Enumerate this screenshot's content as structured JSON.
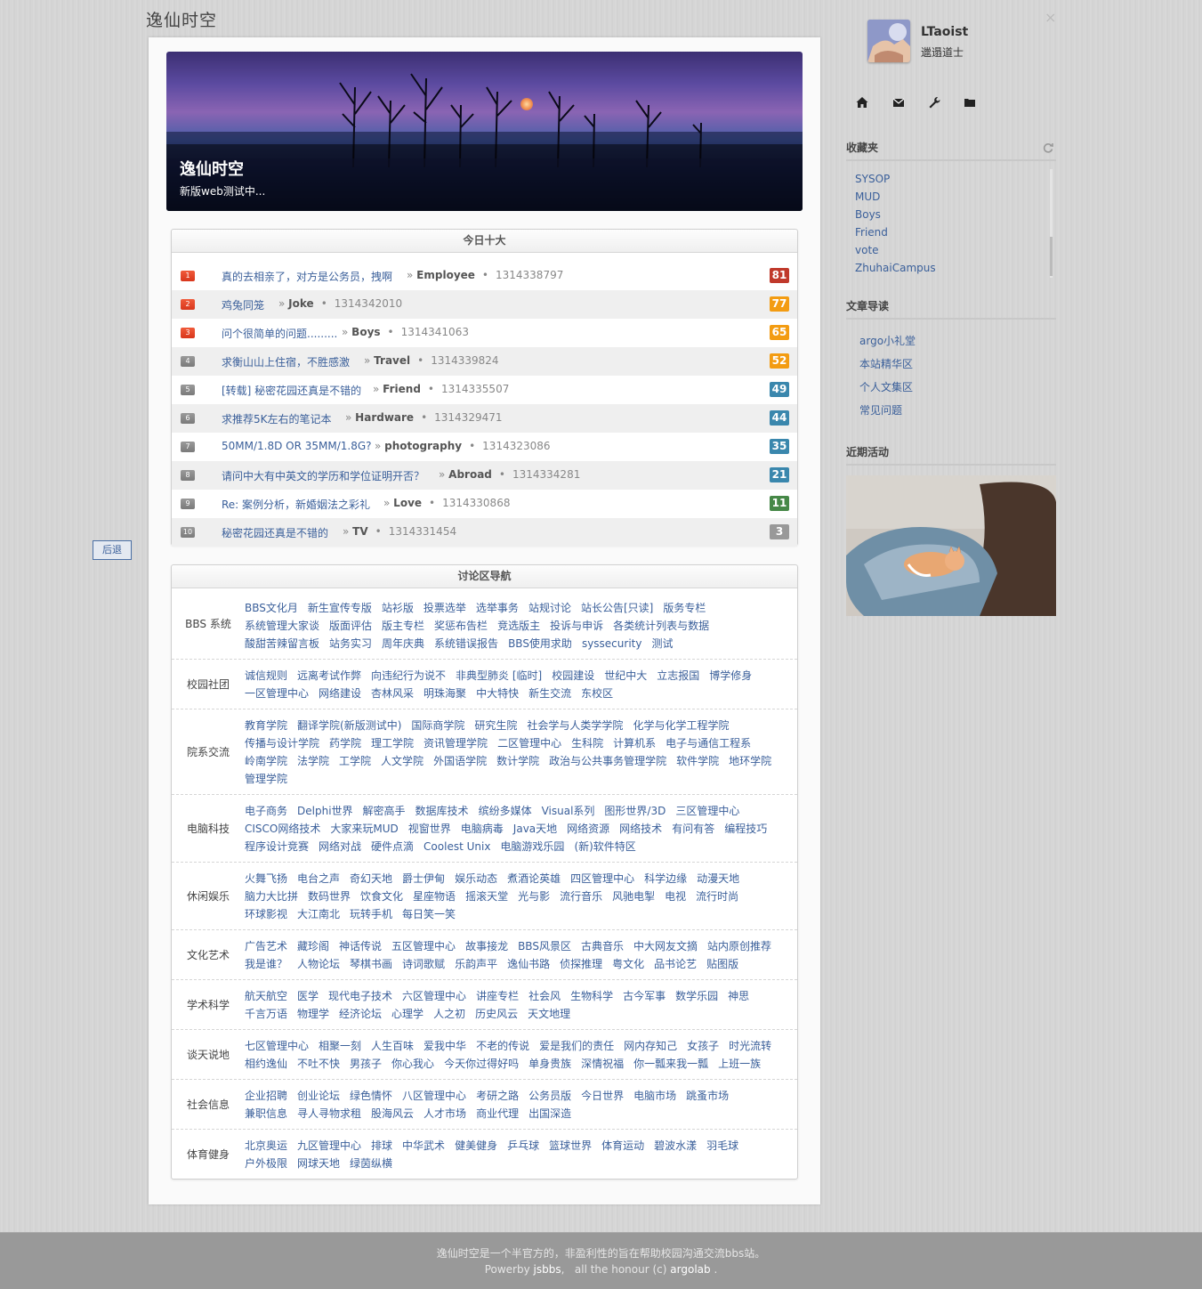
{
  "site": {
    "title": "逸仙时空"
  },
  "banner": {
    "title": "逸仙时空",
    "subtitle": "新版web测试中..."
  },
  "top_ten": {
    "heading": "今日十大",
    "items": [
      {
        "rank": "1",
        "title": "真的去相亲了，对方是公务员，拽啊",
        "prefix": "»",
        "board": "Employee",
        "bullet": "•",
        "id": "1314338797",
        "score": "81",
        "score_color": "#c0392b"
      },
      {
        "rank": "2",
        "title": "鸡兔同笼",
        "prefix": "»",
        "board": "Joke",
        "bullet": "•",
        "id": "1314342010",
        "score": "77",
        "score_color": "#f39c12"
      },
      {
        "rank": "3",
        "title": "问个很简单的问题.........",
        "prefix": "»",
        "board": "Boys",
        "bullet": "•",
        "id": "1314341063",
        "score": "65",
        "score_color": "#f39c12"
      },
      {
        "rank": "4",
        "title": "求衡山山上住宿，不胜感激",
        "prefix": "»",
        "board": "Travel",
        "bullet": "•",
        "id": "1314339824",
        "score": "52",
        "score_color": "#f39c12"
      },
      {
        "rank": "5",
        "title": "[转载] 秘密花园还真是不错的",
        "prefix": "»",
        "board": "Friend",
        "bullet": "•",
        "id": "1314335507",
        "score": "49",
        "score_color": "#3a87ad"
      },
      {
        "rank": "6",
        "title": "求推荐5K左右的笔记本",
        "prefix": "»",
        "board": "Hardware",
        "bullet": "•",
        "id": "1314329471",
        "score": "44",
        "score_color": "#3a87ad"
      },
      {
        "rank": "7",
        "title": "50MM/1.8D OR 35MM/1.8G?",
        "prefix": "»",
        "board": "photography",
        "bullet": "•",
        "id": "1314323086",
        "score": "35",
        "score_color": "#3a87ad"
      },
      {
        "rank": "8",
        "title": "请问中大有中英文的学历和学位证明开否？",
        "prefix": "»",
        "board": "Abroad",
        "bullet": "•",
        "id": "1314334281",
        "score": "21",
        "score_color": "#3a87ad"
      },
      {
        "rank": "9",
        "title": "Re: 案例分析，新婚姻法之彩礼",
        "prefix": "»",
        "board": "Love",
        "bullet": "•",
        "id": "1314330868",
        "score": "11",
        "score_color": "#468847"
      },
      {
        "rank": "10",
        "title": "秘密花园还真是不错的",
        "prefix": "»",
        "board": "TV",
        "bullet": "•",
        "id": "1314331454",
        "score": "3",
        "score_color": "#999999"
      }
    ]
  },
  "nav": {
    "heading": "讨论区导航",
    "sections": [
      {
        "label": "BBS 系统",
        "links": [
          "BBS文化月",
          "新生宣传专版",
          "站衫版",
          "投票选举",
          "选举事务",
          "站规讨论",
          "站长公告[只读]",
          "版务专栏",
          "系统管理大家谈",
          "版面评估",
          "版主专栏",
          "奖惩布告栏",
          "竞选版主",
          "投诉与申诉",
          "各类统计列表与数据",
          "酸甜苦辣留言板",
          "站务实习",
          "周年庆典",
          "系统错误报告",
          "BBS使用求助",
          "syssecurity",
          "测试"
        ]
      },
      {
        "label": "校园社团",
        "links": [
          "诚信规则",
          "远离考试作弊",
          "向违纪行为说不",
          "非典型肺炎 [临时]",
          "校园建设",
          "世纪中大",
          "立志报国",
          "博学修身",
          "一区管理中心",
          "网络建设",
          "杏林风采",
          "明珠海聚",
          "中大特快",
          "新生交流",
          "东校区"
        ]
      },
      {
        "label": "院系交流",
        "links": [
          "教育学院",
          "翻译学院(新版测试中)",
          "国际商学院",
          "研究生院",
          "社会学与人类学学院",
          "化学与化学工程学院",
          "传播与设计学院",
          "药学院",
          "理工学院",
          "资讯管理学院",
          "二区管理中心",
          "生科院",
          "计算机系",
          "电子与通信工程系",
          "岭南学院",
          "法学院",
          "工学院",
          "人文学院",
          "外国语学院",
          "数计学院",
          "政治与公共事务管理学院",
          "软件学院",
          "地环学院",
          "管理学院"
        ]
      },
      {
        "label": "电脑科技",
        "links": [
          "电子商务",
          "Delphi世界",
          "解密高手",
          "数据库技术",
          "缤纷多媒体",
          "Visual系列",
          "图形世界/3D",
          "三区管理中心",
          "CISCO网络技术",
          "大家来玩MUD",
          "视窗世界",
          "电脑病毒",
          "Java天地",
          "网络资源",
          "网络技术",
          "有问有答",
          "编程技巧",
          "程序设计竞赛",
          "网络对战",
          "硬件点滴",
          "Coolest Unix",
          "电脑游戏乐园",
          "(新)软件特区"
        ]
      },
      {
        "label": "休闲娱乐",
        "links": [
          "火舞飞扬",
          "电台之声",
          "奇幻天地",
          "爵士伊甸",
          "娱乐动态",
          "煮酒论英雄",
          "四区管理中心",
          "科学边缘",
          "动漫天地",
          "脑力大比拼",
          "数码世界",
          "饮食文化",
          "星座物语",
          "摇滚天堂",
          "光与影",
          "流行音乐",
          "风驰电掣",
          "电视",
          "流行时尚",
          "环球影视",
          "大江南北",
          "玩转手机",
          "每日笑一笑"
        ]
      },
      {
        "label": "文化艺术",
        "links": [
          "广告艺术",
          "藏珍阁",
          "神话传说",
          "五区管理中心",
          "故事接龙",
          "BBS风景区",
          "古典音乐",
          "中大网友文摘",
          "站内原创推荐",
          "我是谁？",
          "人物论坛",
          "琴棋书画",
          "诗词歌赋",
          "乐韵声平",
          "逸仙书路",
          "侦探推理",
          "粤文化",
          "品书论艺",
          "贴图版"
        ]
      },
      {
        "label": "学术科学",
        "links": [
          "航天航空",
          "医学",
          "现代电子技术",
          "六区管理中心",
          "讲座专栏",
          "社会风",
          "生物科学",
          "古今军事",
          "数学乐园",
          "神思",
          "千言万语",
          "物理学",
          "经济论坛",
          "心理学",
          "人之初",
          "历史风云",
          "天文地理"
        ]
      },
      {
        "label": "谈天说地",
        "links": [
          "七区管理中心",
          "相聚一刻",
          "人生百味",
          "爱我中华",
          "不老的传说",
          "爱是我们的责任",
          "网内存知己",
          "女孩子",
          "时光流转",
          "相约逸仙",
          "不吐不快",
          "男孩子",
          "你心我心",
          "今天你过得好吗",
          "单身贵族",
          "深情祝福",
          "你一瓢来我一瓢",
          "上班一族"
        ]
      },
      {
        "label": "社会信息",
        "links": [
          "企业招聘",
          "创业论坛",
          "绿色情怀",
          "八区管理中心",
          "考研之路",
          "公务员版",
          "今日世界",
          "电脑市场",
          "跳蚤市场",
          "兼职信息",
          "寻人寻物求租",
          "股海风云",
          "人才市场",
          "商业代理",
          "出国深造"
        ]
      },
      {
        "label": "体育健身",
        "links": [
          "北京奥运",
          "九区管理中心",
          "排球",
          "中华武术",
          "健美健身",
          "乒乓球",
          "篮球世界",
          "体育运动",
          "碧波水漾",
          "羽毛球",
          "户外极限",
          "网球天地",
          "绿茵纵横"
        ]
      }
    ]
  },
  "back_button": "后退",
  "user": {
    "name": "LTaoist",
    "title": "邋遢道士",
    "close_glyph": "×"
  },
  "toolbar": {
    "icons": [
      "home-icon",
      "mail-icon",
      "wrench-icon",
      "folder-icon"
    ]
  },
  "favorites": {
    "heading": "收藏夹",
    "items": [
      "SYSOP",
      "MUD",
      "Boys",
      "Friend",
      "vote",
      "ZhuhaiCampus"
    ]
  },
  "guide": {
    "heading": "文章导读",
    "items": [
      "argo小礼堂",
      "本站精华区",
      "个人文集区",
      "常见问题"
    ]
  },
  "activity": {
    "heading": "近期活动"
  },
  "footer": {
    "line1": "逸仙时空是一个半官方的，非盈利性的旨在帮助校园沟通交流bbs站。",
    "powerby": "Powerby",
    "jsbbs": "jsbbs",
    "comma": ",",
    "honour": "all the honour (c)",
    "argolab": "argolab",
    "dot": "."
  }
}
